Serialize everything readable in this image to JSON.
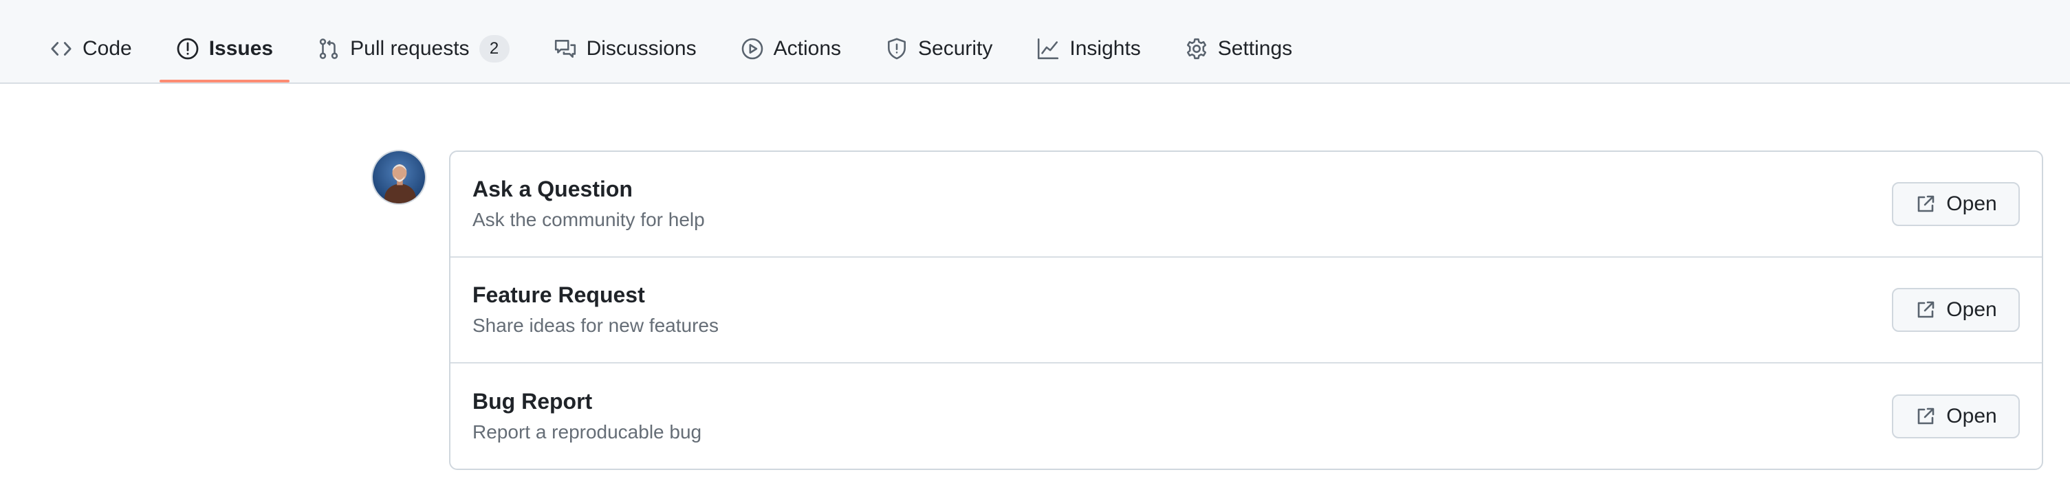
{
  "nav": {
    "tabs": [
      {
        "label": "Code",
        "icon": "code-icon",
        "selected": false
      },
      {
        "label": "Issues",
        "icon": "issue-opened-icon",
        "selected": true
      },
      {
        "label": "Pull requests",
        "icon": "git-pull-request-icon",
        "selected": false,
        "counter": "2"
      },
      {
        "label": "Discussions",
        "icon": "comment-discussion-icon",
        "selected": false
      },
      {
        "label": "Actions",
        "icon": "play-icon",
        "selected": false
      },
      {
        "label": "Security",
        "icon": "shield-icon",
        "selected": false
      },
      {
        "label": "Insights",
        "icon": "graph-icon",
        "selected": false
      },
      {
        "label": "Settings",
        "icon": "gear-icon",
        "selected": false
      }
    ],
    "selected_underline_color": "#fd8c73"
  },
  "templates": [
    {
      "title": "Ask a Question",
      "description": "Ask the community for help",
      "button_label": "Open",
      "button_icon": "link-external-icon"
    },
    {
      "title": "Feature Request",
      "description": "Share ideas for new features",
      "button_label": "Open",
      "button_icon": "link-external-icon"
    },
    {
      "title": "Bug Report",
      "description": "Report a reproducable bug",
      "button_label": "Open",
      "button_icon": "link-external-icon"
    }
  ]
}
